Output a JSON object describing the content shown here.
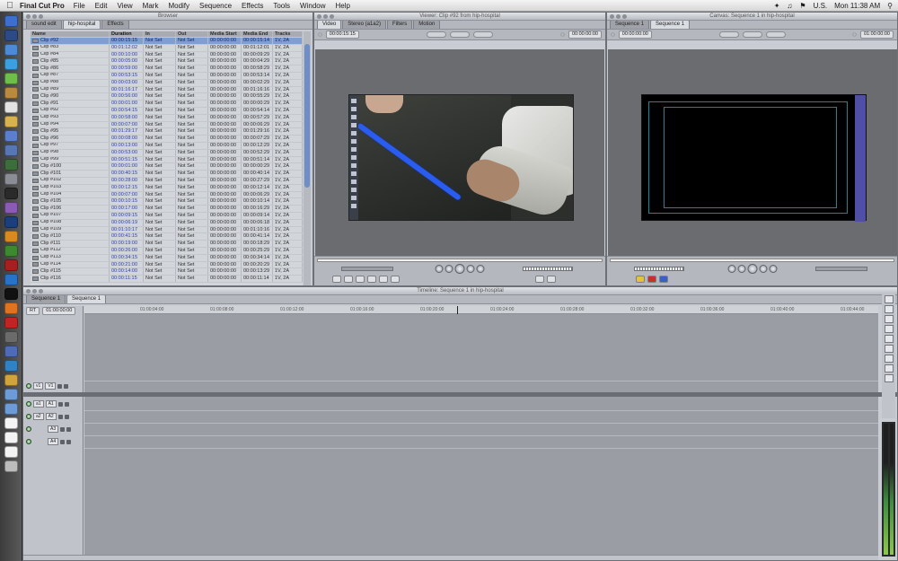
{
  "menubar": {
    "app": "Final Cut Pro",
    "items": [
      "File",
      "Edit",
      "View",
      "Mark",
      "Modify",
      "Sequence",
      "Effects",
      "Tools",
      "Window",
      "Help"
    ],
    "locale": "U.S.",
    "clock": "Mon 11:38 AM"
  },
  "browser": {
    "title": "Browser",
    "tabs": [
      "sound edit",
      "hip-hospital",
      "Effects"
    ],
    "columns": [
      "Name",
      "Duration",
      "In",
      "Out",
      "Media Start",
      "Media End",
      "Tracks"
    ],
    "rows": [
      [
        "Clip #92",
        "00:00:15:15",
        "Not Set",
        "Not Set",
        "00:00:00:00",
        "00:00:15:14",
        "1V, 2A"
      ],
      [
        "Clip #83",
        "00:01:12:02",
        "Not Set",
        "Not Set",
        "00:00:00:00",
        "00:01:12:01",
        "1V, 2A"
      ],
      [
        "Clip #84",
        "00:00:10:00",
        "Not Set",
        "Not Set",
        "00:00:00:00",
        "00:00:09:29",
        "1V, 2A"
      ],
      [
        "Clip #85",
        "00:00:05:00",
        "Not Set",
        "Not Set",
        "00:00:00:00",
        "00:00:04:29",
        "1V, 2A"
      ],
      [
        "Clip #86",
        "00:00:59:00",
        "Not Set",
        "Not Set",
        "00:00:00:00",
        "00:00:58:29",
        "1V, 2A"
      ],
      [
        "Clip #87",
        "00:00:53:15",
        "Not Set",
        "Not Set",
        "00:00:00:00",
        "00:00:53:14",
        "1V, 2A"
      ],
      [
        "Clip #88",
        "00:00:03:00",
        "Not Set",
        "Not Set",
        "00:00:00:00",
        "00:00:02:29",
        "1V, 2A"
      ],
      [
        "Clip #89",
        "00:01:16:17",
        "Not Set",
        "Not Set",
        "00:00:00:00",
        "00:01:16:16",
        "1V, 2A"
      ],
      [
        "Clip #90",
        "00:00:56:00",
        "Not Set",
        "Not Set",
        "00:00:00:00",
        "00:00:55:29",
        "1V, 2A"
      ],
      [
        "Clip #91",
        "00:00:01:00",
        "Not Set",
        "Not Set",
        "00:00:00:00",
        "00:00:00:29",
        "1V, 2A"
      ],
      [
        "Clip #92",
        "00:00:54:15",
        "Not Set",
        "Not Set",
        "00:00:00:00",
        "00:00:54:14",
        "1V, 2A"
      ],
      [
        "Clip #93",
        "00:00:58:00",
        "Not Set",
        "Not Set",
        "00:00:00:00",
        "00:00:57:29",
        "1V, 2A"
      ],
      [
        "Clip #94",
        "00:00:07:00",
        "Not Set",
        "Not Set",
        "00:00:00:00",
        "00:00:06:29",
        "1V, 2A"
      ],
      [
        "Clip #95",
        "00:01:29:17",
        "Not Set",
        "Not Set",
        "00:00:00:00",
        "00:01:29:16",
        "1V, 2A"
      ],
      [
        "Clip #96",
        "00:00:08:00",
        "Not Set",
        "Not Set",
        "00:00:00:00",
        "00:00:07:29",
        "1V, 2A"
      ],
      [
        "Clip #97",
        "00:00:13:00",
        "Not Set",
        "Not Set",
        "00:00:00:00",
        "00:00:12:29",
        "1V, 2A"
      ],
      [
        "Clip #98",
        "00:00:53:00",
        "Not Set",
        "Not Set",
        "00:00:00:00",
        "00:00:52:29",
        "1V, 2A"
      ],
      [
        "Clip #99",
        "00:00:51:15",
        "Not Set",
        "Not Set",
        "00:00:00:00",
        "00:00:51:14",
        "1V, 2A"
      ],
      [
        "Clip #100",
        "00:00:01:00",
        "Not Set",
        "Not Set",
        "00:00:00:00",
        "00:00:00:29",
        "1V, 2A"
      ],
      [
        "Clip #101",
        "00:00:40:15",
        "Not Set",
        "Not Set",
        "00:00:00:00",
        "00:00:40:14",
        "1V, 2A"
      ],
      [
        "Clip #102",
        "00:00:28:00",
        "Not Set",
        "Not Set",
        "00:00:00:00",
        "00:00:27:29",
        "1V, 2A"
      ],
      [
        "Clip #103",
        "00:00:12:15",
        "Not Set",
        "Not Set",
        "00:00:00:00",
        "00:00:12:14",
        "1V, 2A"
      ],
      [
        "Clip #104",
        "00:00:07:00",
        "Not Set",
        "Not Set",
        "00:00:00:00",
        "00:00:06:29",
        "1V, 2A"
      ],
      [
        "Clip #105",
        "00:00:10:15",
        "Not Set",
        "Not Set",
        "00:00:00:00",
        "00:00:10:14",
        "1V, 2A"
      ],
      [
        "Clip #106",
        "00:00:17:00",
        "Not Set",
        "Not Set",
        "00:00:00:00",
        "00:00:16:29",
        "1V, 2A"
      ],
      [
        "Clip #107",
        "00:00:09:15",
        "Not Set",
        "Not Set",
        "00:00:00:00",
        "00:00:09:14",
        "1V, 2A"
      ],
      [
        "Clip #108",
        "00:00:06:19",
        "Not Set",
        "Not Set",
        "00:00:00:00",
        "00:00:06:18",
        "1V, 2A"
      ],
      [
        "Clip #109",
        "00:01:10:17",
        "Not Set",
        "Not Set",
        "00:00:00:00",
        "00:01:10:16",
        "1V, 2A"
      ],
      [
        "Clip #110",
        "00:00:41:15",
        "Not Set",
        "Not Set",
        "00:00:00:00",
        "00:00:41:14",
        "1V, 2A"
      ],
      [
        "Clip #111",
        "00:00:19:00",
        "Not Set",
        "Not Set",
        "00:00:00:00",
        "00:00:18:29",
        "1V, 2A"
      ],
      [
        "Clip #112",
        "00:00:26:00",
        "Not Set",
        "Not Set",
        "00:00:00:00",
        "00:00:25:29",
        "1V, 2A"
      ],
      [
        "Clip #113",
        "00:00:34:15",
        "Not Set",
        "Not Set",
        "00:00:00:00",
        "00:00:34:14",
        "1V, 2A"
      ],
      [
        "Clip #114",
        "00:00:21:00",
        "Not Set",
        "Not Set",
        "00:00:00:00",
        "00:00:20:29",
        "1V, 2A"
      ],
      [
        "Clip #115",
        "00:00:14:00",
        "Not Set",
        "Not Set",
        "00:00:00:00",
        "00:00:13:29",
        "1V, 2A"
      ],
      [
        "Clip #116",
        "00:00:11:15",
        "Not Set",
        "Not Set",
        "00:00:00:00",
        "00:00:11:14",
        "1V, 2A"
      ]
    ]
  },
  "viewer": {
    "title": "Viewer: Clip #92 from hip-hospital",
    "tabs": [
      "Video",
      "Stereo (a1a2)",
      "Filters",
      "Motion"
    ],
    "duration": "00:00:15:15",
    "current": "00:00:00:00"
  },
  "canvas": {
    "title": "Canvas: Sequence 1 in hip-hospital",
    "tabs": [
      "Sequence 1",
      "Sequence 1"
    ],
    "duration": "00:00:00:00",
    "current": "01:00:00:00"
  },
  "timeline": {
    "title": "Timeline: Sequence 1 in hip-hospital",
    "tabs": [
      "Sequence 1",
      "Sequence 1"
    ],
    "rt": "RT",
    "timecode": "01:00:00:00",
    "ruler": [
      "01:00:04:00",
      "01:00:08:00",
      "01:00:12:00",
      "01:00:16:00",
      "01:00:20:00",
      "01:00:24:00",
      "01:00:28:00",
      "01:00:32:00",
      "01:00:36:00",
      "01:00:40:00",
      "01:00:44:00"
    ],
    "video_tracks": [
      {
        "src": "v1",
        "dst": "V1"
      }
    ],
    "audio_tracks": [
      {
        "src": "a1",
        "dst": "A1"
      },
      {
        "src": "a2",
        "dst": "A2"
      },
      {
        "src": "",
        "dst": "A3"
      },
      {
        "src": "",
        "dst": "A4"
      }
    ]
  }
}
